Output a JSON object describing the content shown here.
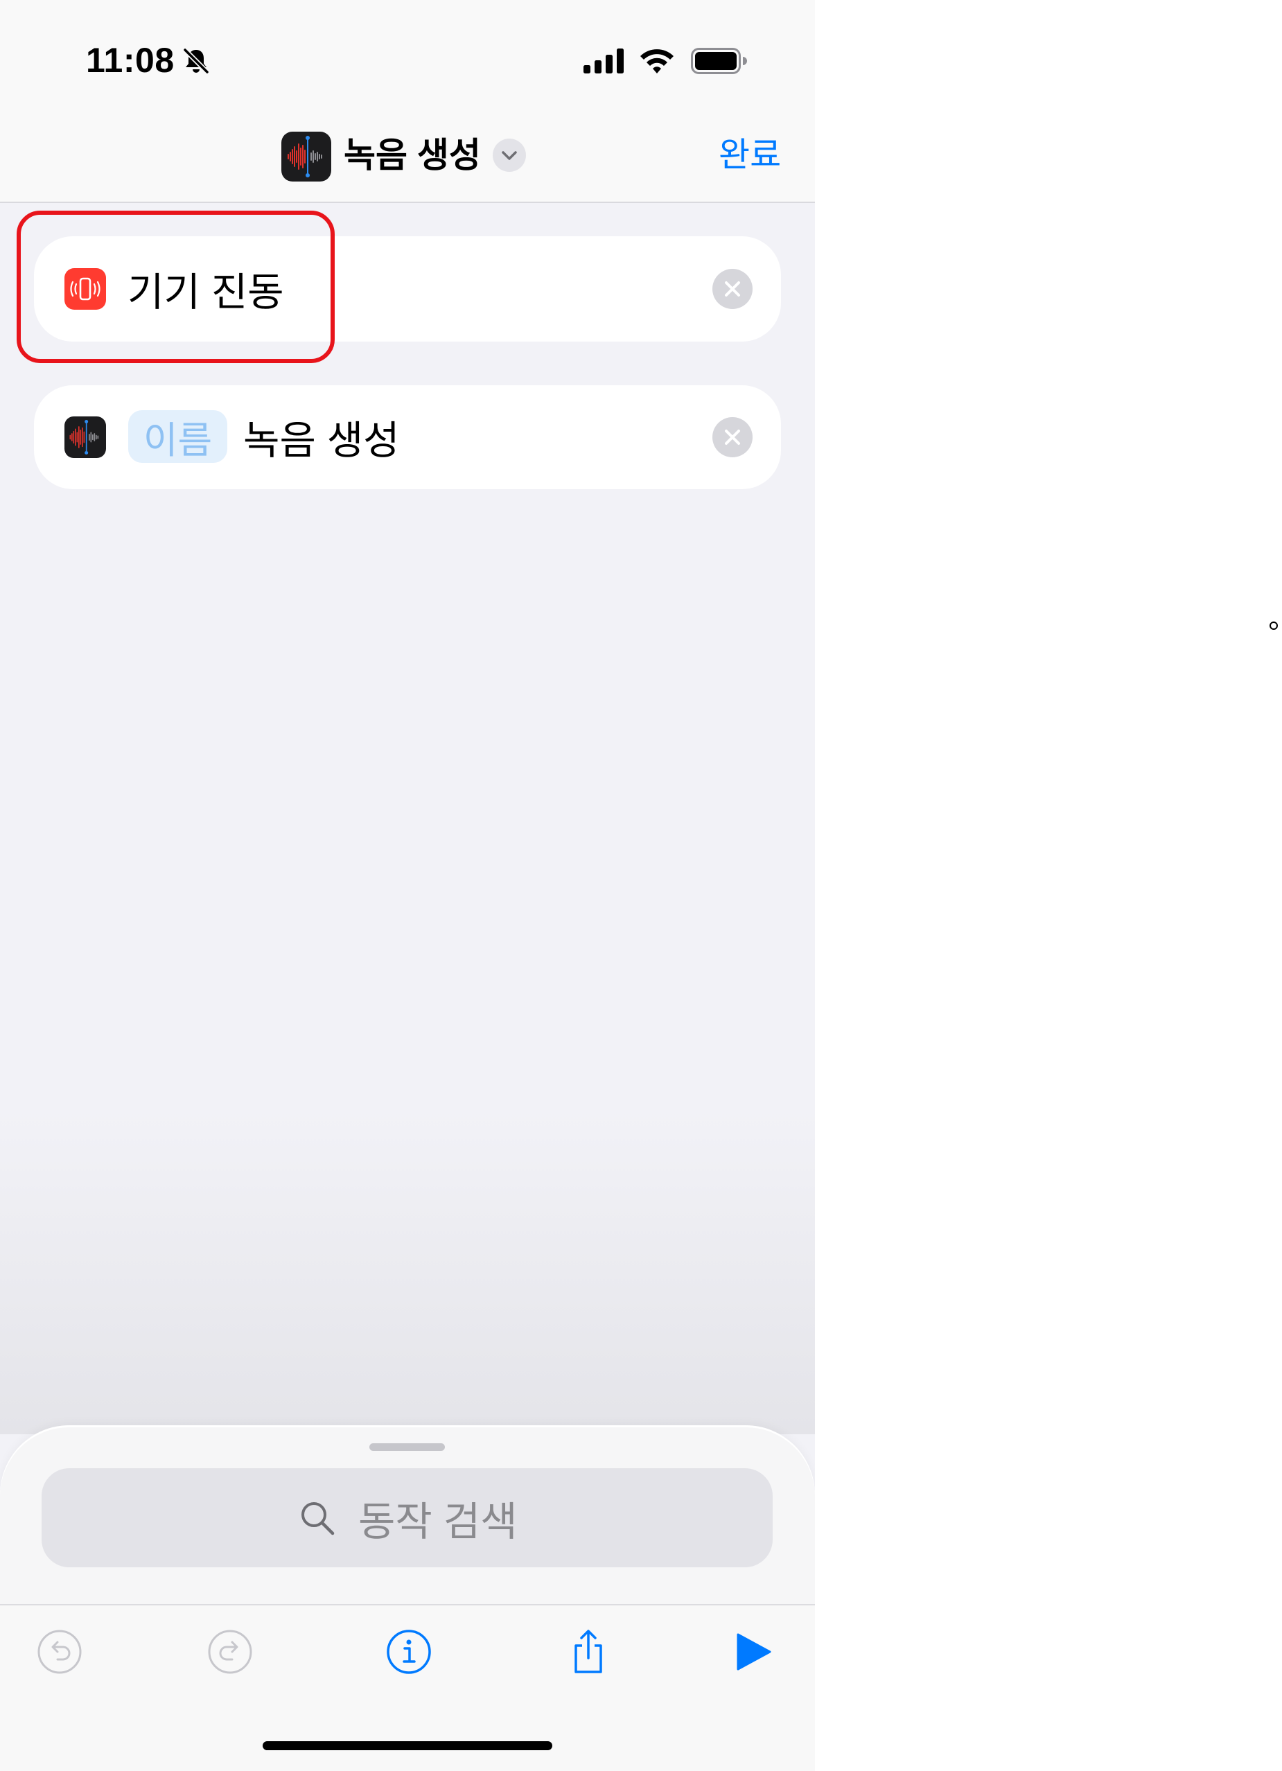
{
  "status_bar": {
    "time": "11:08",
    "icons": [
      "bell-slash-icon",
      "cellular-signal-icon",
      "wifi-icon",
      "battery-icon"
    ]
  },
  "nav": {
    "app_icon": "voice-memos-icon",
    "title": "녹음 생성",
    "menu_icon": "chevron-down-icon",
    "done_label": "완료"
  },
  "actions": [
    {
      "icon": "vibration-icon",
      "label": "기기 진동",
      "remove_icon": "xmark-circle-icon",
      "highlighted": true
    },
    {
      "icon": "voice-memos-icon",
      "param_token": "이름",
      "label": "녹음 생성",
      "remove_icon": "xmark-circle-icon"
    }
  ],
  "search": {
    "icon": "magnifying-glass-icon",
    "placeholder": "동작 검색"
  },
  "toolbar": {
    "icons": [
      "undo-icon",
      "redo-icon",
      "info-icon",
      "share-icon",
      "play-icon"
    ]
  },
  "colors": {
    "accent": "#007AFF",
    "highlight_outline": "#E8141B",
    "vibration_icon_bg": "#FF3B30",
    "param_token_bg": "#E3F0FC",
    "param_token_text": "#8EC1F3",
    "disabled_icon": "#C7C7CC"
  }
}
